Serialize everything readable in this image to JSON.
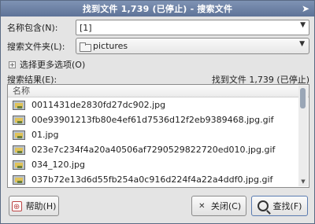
{
  "window": {
    "title": "找到文件 1,739 (已停止) - 搜索文件"
  },
  "form": {
    "name_label": "名称包含(N):",
    "name_value": "[1]",
    "folder_label": "搜索文件夹(L):",
    "folder_value": "pictures",
    "more_options_label": "选择更多选项(O)"
  },
  "results": {
    "label": "搜索结果(E):",
    "status": "找到文件 1,739 (已停止)",
    "column_header": "名称",
    "items": [
      "0011431de2830fd27dc902.jpg",
      "00e93901213fb80e4ef61d7536d12f2eb9389468.jpg.gif",
      "01.jpg",
      "023e7c234f4a20a40506af7290529822720ed010.jpg.gif",
      "034_120.jpg",
      "037b72e13d6d55fb254a0c916d224f4a22a4ddf0.jpg.gif"
    ]
  },
  "buttons": {
    "help": "帮助(H)",
    "close": "关闭(C)",
    "find": "查找(F)"
  }
}
